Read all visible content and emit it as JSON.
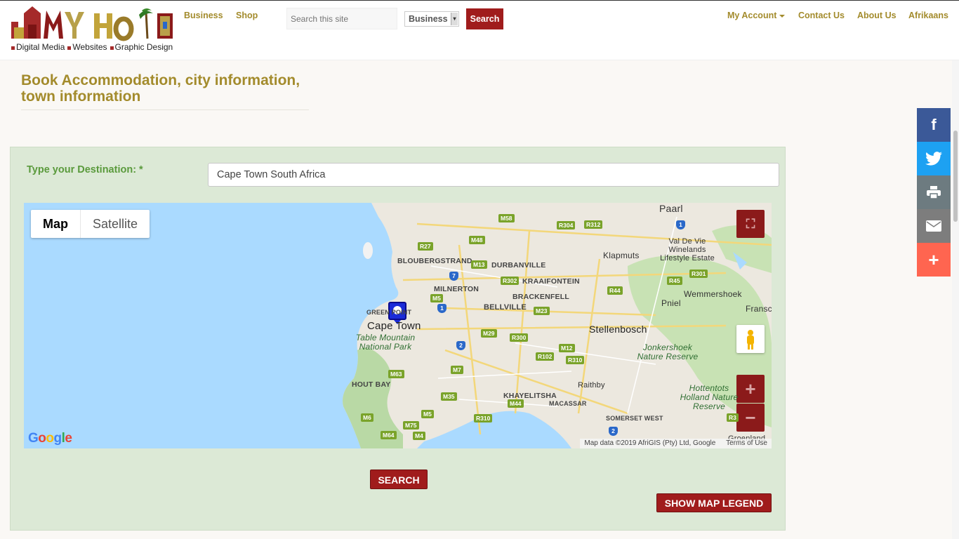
{
  "header": {
    "logo_text": "MyHood",
    "tagline": [
      "Digital Media",
      "Websites",
      "Graphic Design"
    ],
    "nav_left": [
      "Business",
      "Shop"
    ],
    "search_placeholder": "Search this site",
    "search_category": "Business",
    "search_button": "Search",
    "nav_right": {
      "account": "My Account",
      "contact": "Contact Us",
      "about": "About Us",
      "language": "Afrikaans"
    }
  },
  "page": {
    "title": "Book Accommodation, city information, town information"
  },
  "form": {
    "destination_label": "Type your Destination: *",
    "destination_value": "Cape Town South Africa"
  },
  "map": {
    "type_map": "Map",
    "type_satellite": "Satellite",
    "google": "Google",
    "attribution": "Map data ©2019 AfriGIS (Pty) Ltd, Google",
    "terms": "Terms of Use",
    "places": {
      "paarl": "Paarl",
      "cape_town": "Cape Town",
      "stellenbosch": "Stellenbosch",
      "bloubergstrand": "BLOUBERGSTRAND",
      "durbanville": "DURBANVILLE",
      "milnerton": "MILNERTON",
      "kraaifontein": "KRAAIFONTEIN",
      "brackenfell": "BRACKENFELL",
      "bellville": "BELLVILLE",
      "green_point": "GREEN POINT",
      "klapmuts": "Klapmuts",
      "val_de_vie": "Val De Vie Winelands Lifestyle Estate",
      "wemmershoek": "Wemmershoek",
      "pniel": "Pniel",
      "franschhoek": "Fransc",
      "table_mountain": "Table Mountain National Park",
      "jonkershoek": "Jonkershoek Nature Reserve",
      "hottentots": "Hottentots Holland Nature Reserve",
      "hout_bay": "HOUT BAY",
      "khayelitsha": "KHAYELITSHA",
      "macassar": "MACASSAR",
      "raithby": "Raithby",
      "somerset_west": "SOMERSET WEST",
      "groenland": "Groenland"
    },
    "roads": [
      "M58",
      "R304",
      "R312",
      "M48",
      "R27",
      "M13",
      "R302",
      "M5",
      "M23",
      "R44",
      "R45",
      "R301",
      "M29",
      "R300",
      "M12",
      "R102",
      "R310",
      "M7",
      "M63",
      "M35",
      "M44",
      "M5",
      "R310",
      "M6",
      "M75",
      "M64",
      "M4",
      "R3"
    ],
    "highways": [
      "1",
      "7",
      "1",
      "2",
      "2"
    ]
  },
  "buttons": {
    "search": "SEARCH",
    "legend": "SHOW MAP LEGEND"
  },
  "share": {
    "colors": {
      "facebook": "#3b5998",
      "twitter": "#1da1f2",
      "print": "#6d7b80",
      "email": "#7d7d7d",
      "more": "#ff6550"
    }
  },
  "colors": {
    "accent_gold": "#a38b2c",
    "button_red": "#a01c1c",
    "panel_green": "#dce9d6",
    "label_green": "#5a9a3c",
    "water": "#aadaff"
  }
}
